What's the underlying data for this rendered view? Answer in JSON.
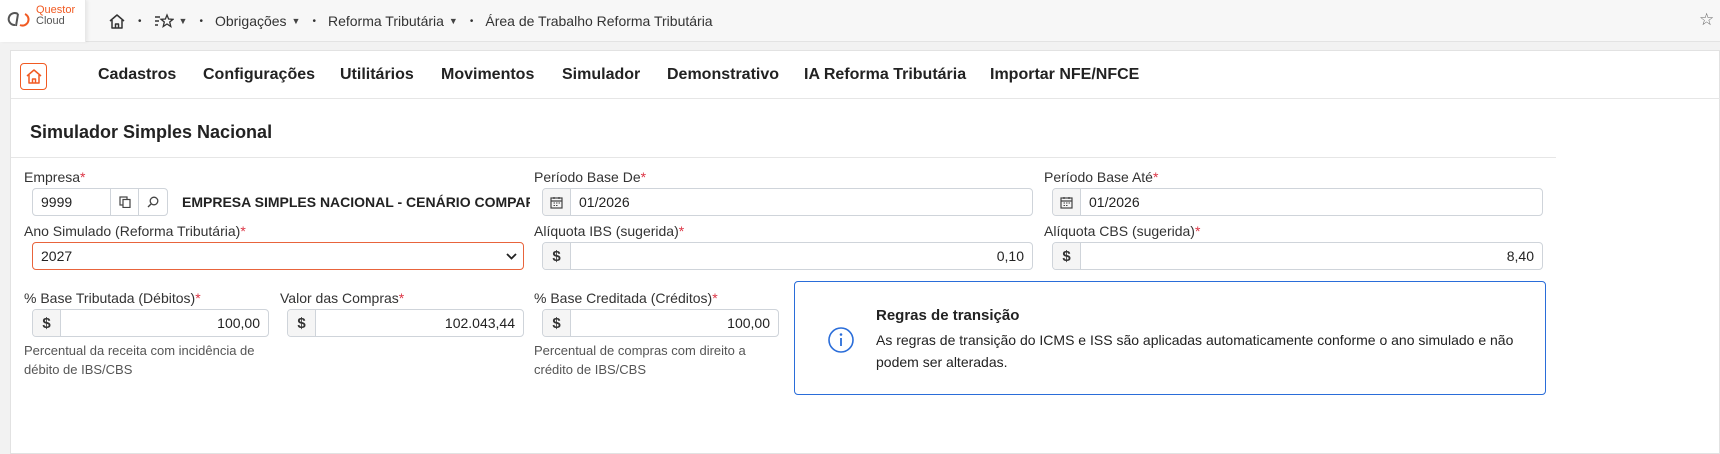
{
  "brand": {
    "line1": "Questor",
    "line2": "Cloud"
  },
  "breadcrumb": {
    "items": [
      {
        "label": "Obrigações"
      },
      {
        "label": "Reforma Tributária"
      },
      {
        "label": "Área de Trabalho Reforma Tributária"
      }
    ]
  },
  "menu": {
    "items": [
      "Cadastros",
      "Configurações",
      "Utilitários",
      "Movimentos",
      "Simulador",
      "Demonstrativo",
      "IA Reforma Tributária",
      "Importar NFE/NFCE"
    ]
  },
  "page": {
    "title": "Simulador Simples Nacional"
  },
  "form": {
    "empresa": {
      "label": "Empresa",
      "required": "*",
      "code": "9999",
      "name": "EMPRESA SIMPLES NACIONAL - CENÁRIO COMPARAT"
    },
    "periodo_de": {
      "label": "Período Base De",
      "required": "*",
      "value": "01/2026"
    },
    "periodo_ate": {
      "label": "Período Base Até",
      "required": "*",
      "value": "01/2026"
    },
    "ano_simulado": {
      "label": "Ano Simulado (Reforma Tributária)",
      "required": "*",
      "value": "2027"
    },
    "aliquota_ibs": {
      "label": "Alíquota IBS (sugerida)",
      "required": "*",
      "prefix": "$",
      "value": "0,10"
    },
    "aliquota_cbs": {
      "label": "Alíquota CBS (sugerida)",
      "required": "*",
      "prefix": "$",
      "value": "8,40"
    },
    "base_tributada": {
      "label": "% Base Tributada (Débitos)",
      "required": "*",
      "prefix": "$",
      "value": "100,00",
      "help": "Percentual da receita com incidência de débito de IBS/CBS"
    },
    "valor_compras": {
      "label": "Valor das Compras",
      "required": "*",
      "prefix": "$",
      "value": "102.043,44"
    },
    "base_creditada": {
      "label": "% Base Creditada (Créditos)",
      "required": "*",
      "prefix": "$",
      "value": "100,00",
      "help": "Percentual de compras com direito a crédito de IBS/CBS"
    }
  },
  "info": {
    "title": "Regras de transição",
    "text": "As regras de transição do ICMS e ISS são aplicadas automaticamente conforme o ano simulado e não podem ser alteradas."
  },
  "colors": {
    "accent": "#f15a22",
    "required": "#dc3545",
    "info_border": "#2a6dd9",
    "select_border": "#e8643c"
  }
}
